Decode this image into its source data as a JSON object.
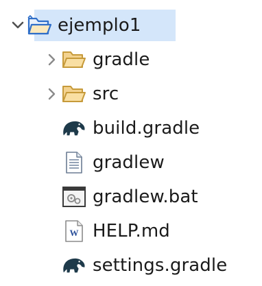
{
  "explorer": {
    "root": {
      "label": "ejemplo1",
      "icon": "project-folder-icon",
      "expanded": true,
      "selected": true
    },
    "children": [
      {
        "label": "gradle",
        "icon": "folder-icon",
        "expandable": true
      },
      {
        "label": "src",
        "icon": "folder-icon",
        "expandable": true
      },
      {
        "label": "build.gradle",
        "icon": "gradle-elephant-icon",
        "expandable": false
      },
      {
        "label": "gradlew",
        "icon": "text-file-icon",
        "expandable": false
      },
      {
        "label": "gradlew.bat",
        "icon": "batch-file-icon",
        "expandable": false
      },
      {
        "label": "HELP.md",
        "icon": "word-document-icon",
        "expandable": false
      },
      {
        "label": "settings.gradle",
        "icon": "gradle-elephant-icon",
        "expandable": false
      }
    ]
  },
  "colors": {
    "selection": "#d4e6fa",
    "folder_fill": "#f7d48a",
    "folder_stroke": "#c69a3a",
    "project_folder_stroke": "#2f6fc9",
    "gradle_icon": "#1e3a4a",
    "chevron": "#707070"
  }
}
